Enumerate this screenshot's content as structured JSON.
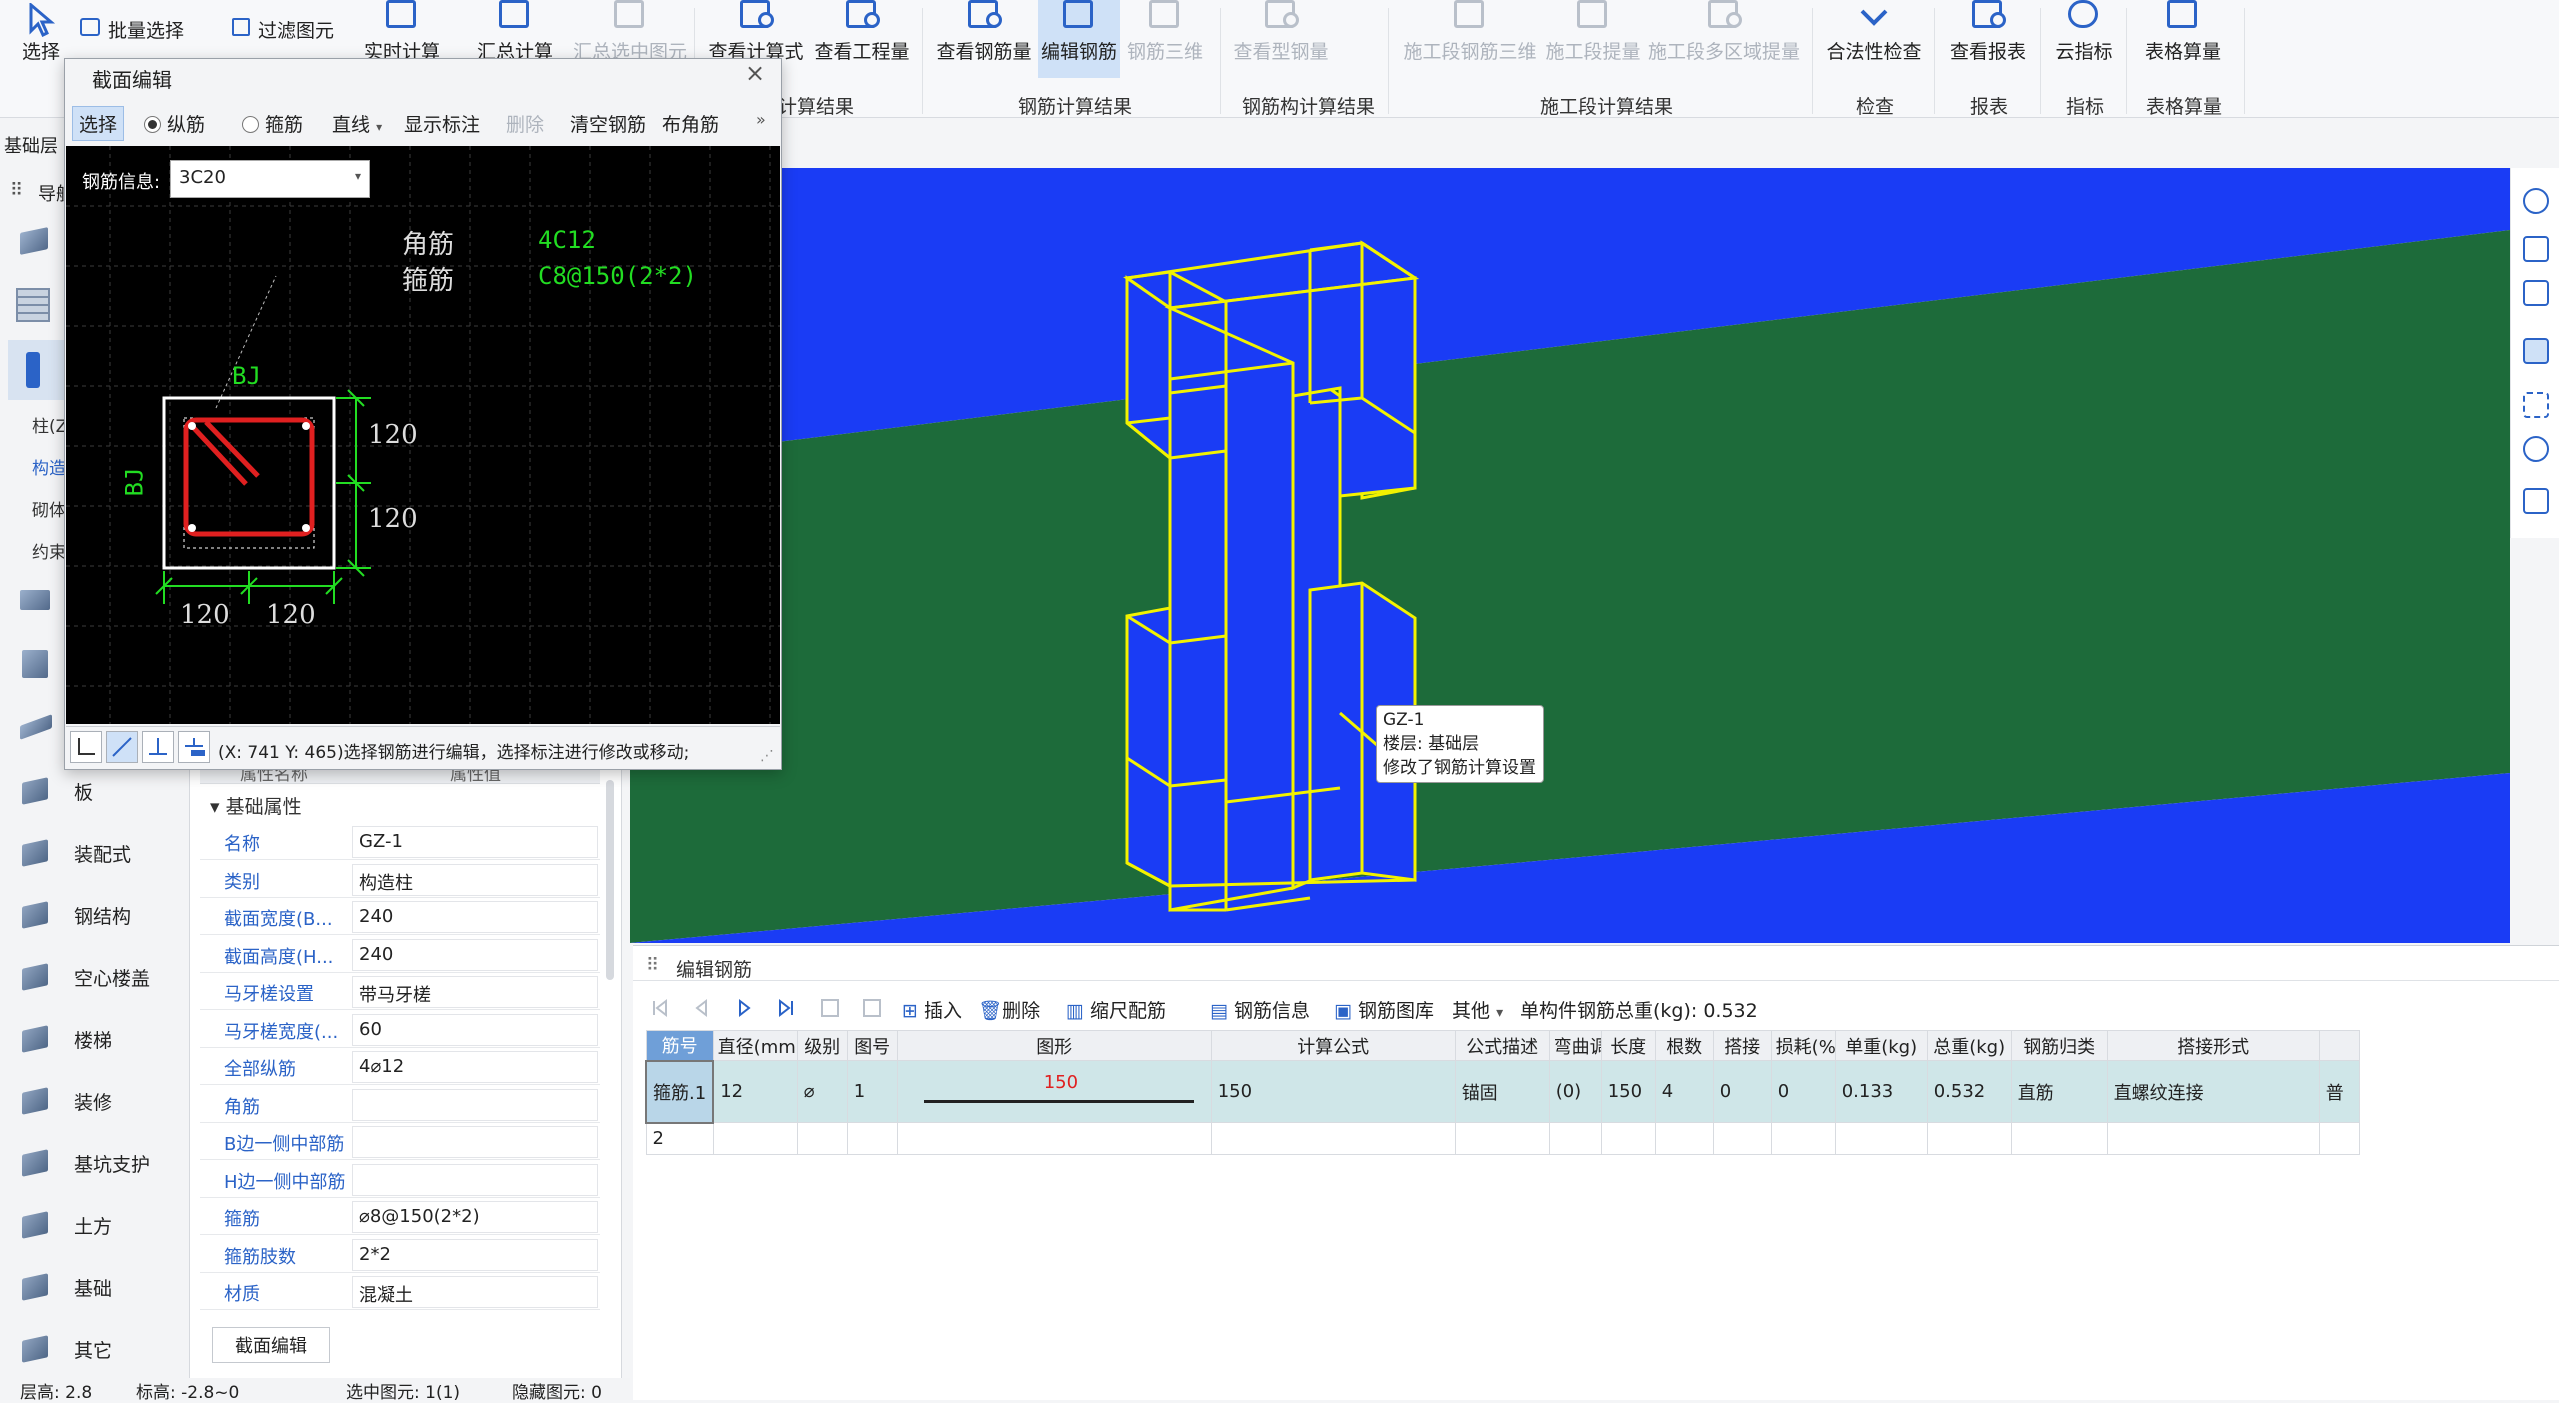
{
  "ribbon": {
    "buttons": [
      {
        "label": "选择",
        "icon": "select-arrow-icon"
      },
      {
        "label": "实时计算",
        "icon": "realtime-calc-icon"
      },
      {
        "label": "汇总计算",
        "icon": "sum-calc-icon"
      },
      {
        "label": "汇总选中图元",
        "icon": "sum-selected-icon"
      },
      {
        "label": "查看计算式",
        "icon": "view-formula-icon"
      },
      {
        "label": "查看工程量",
        "icon": "view-quantity-icon"
      },
      {
        "label": "查看钢筋量",
        "icon": "view-rebar-icon"
      },
      {
        "label": "编辑钢筋",
        "icon": "edit-rebar-icon"
      },
      {
        "label": "钢筋三维",
        "icon": "rebar-3d-icon"
      },
      {
        "label": "查看型钢量",
        "icon": "view-steel-icon"
      },
      {
        "label": "施工段钢筋三维",
        "icon": "segment-rebar-3d-icon"
      },
      {
        "label": "施工段提量",
        "icon": "segment-quantity-icon"
      },
      {
        "label": "施工段多区域提量",
        "icon": "segment-multi-area-icon"
      },
      {
        "label": "合法性检查",
        "icon": "check-icon"
      },
      {
        "label": "查看报表",
        "icon": "report-icon"
      },
      {
        "label": "云指标",
        "icon": "cloud-icon"
      },
      {
        "label": "表格算量",
        "icon": "table-calc-icon"
      }
    ],
    "small_buttons": [
      "批量选择",
      "过滤图元"
    ],
    "groups": [
      "计算结果",
      "钢筋计算结果",
      "钢筋构计算结果",
      "施工段计算结果",
      "检查",
      "报表",
      "指标",
      "表格算量"
    ]
  },
  "floor_label": "基础层",
  "nav_label": "导航",
  "sidebar": {
    "sub_items": [
      "柱(Z)",
      "构造",
      "砌体",
      "约束"
    ],
    "items": [
      "板",
      "装配式",
      "钢结构",
      "空心楼盖",
      "楼梯",
      "装修",
      "基坑支护",
      "土方",
      "基础",
      "其它"
    ]
  },
  "properties": {
    "col_header": "属性名称",
    "col_header_value": "属性值",
    "section": "基础属性",
    "rows": [
      {
        "key": "名称",
        "value": "GZ-1"
      },
      {
        "key": "类别",
        "value": "构造柱"
      },
      {
        "key": "截面宽度(B...",
        "value": "240"
      },
      {
        "key": "截面高度(H...",
        "value": "240"
      },
      {
        "key": "马牙槎设置",
        "value": "带马牙槎"
      },
      {
        "key": "马牙槎宽度(...",
        "value": "60"
      },
      {
        "key": "全部纵筋",
        "value": "4⌀12"
      },
      {
        "key": "角筋",
        "value": ""
      },
      {
        "key": "B边一侧中部筋",
        "value": ""
      },
      {
        "key": "H边一侧中部筋",
        "value": ""
      },
      {
        "key": "箍筋",
        "value": "⌀8@150(2*2)"
      },
      {
        "key": "箍筋肢数",
        "value": "2*2"
      },
      {
        "key": "材质",
        "value": "混凝土"
      }
    ],
    "edit_button": "截面编辑"
  },
  "status": {
    "floor_height": "层高: 2.8",
    "elevation": "标高: -2.8~0",
    "selected": "选中图元: 1(1)",
    "hidden": "隐藏图元: 0"
  },
  "tooltip": {
    "name": "GZ-1",
    "floor": "楼层: 基础层",
    "note": "修改了钢筋计算设置"
  },
  "dialog": {
    "title": "截面编辑",
    "toolbar": {
      "select": "选择",
      "longitudinal": "纵筋",
      "stirrup": "箍筋",
      "line": "直线",
      "show_dims": "显示标注",
      "delete": "删除",
      "clear": "清空钢筋",
      "corner": "布角筋"
    },
    "rebar_info_label": "钢筋信息:",
    "rebar_info_value": "3C20",
    "canvas": {
      "label_corner": "角筋",
      "label_stirrup": "箍筋",
      "value_corner": "4C12",
      "value_stirrup": "C8@150(2*2)",
      "bj_top": "BJ",
      "bj_left": "BJ",
      "dim_right_1": "120",
      "dim_right_2": "120",
      "dim_bottom_1": "120",
      "dim_bottom_2": "120"
    },
    "footer_text": "(X: 741 Y: 465)选择钢筋进行编辑，选择标注进行修改或移动;"
  },
  "rebar_panel": {
    "title": "编辑钢筋",
    "toolbar": {
      "insert": "插入",
      "delete": "删除",
      "scale": "缩尺配筋",
      "info": "钢筋信息",
      "library": "钢筋图库",
      "other": "其他",
      "total": "单构件钢筋总重(kg): 0.532"
    },
    "columns": [
      "筋号",
      "直径(mm)",
      "级别",
      "图号",
      "图形",
      "计算公式",
      "公式描述",
      "弯曲调整",
      "长度",
      "根数",
      "搭接",
      "损耗(%)",
      "单重(kg)",
      "总重(kg)",
      "钢筋归类",
      "搭接形式",
      ""
    ],
    "rows": [
      {
        "num": "1",
        "name": "箍筋.1",
        "diameter": "12",
        "grade": "⌀",
        "fig": "1",
        "shape_value": "150",
        "formula": "150",
        "desc": "锚固",
        "bend": "(0)",
        "length": "150",
        "count": "4",
        "lap": "0",
        "loss": "0",
        "unit_weight": "0.133",
        "total_weight": "0.532",
        "category": "直筋",
        "lap_type": "直螺纹连接",
        "extra": "普"
      }
    ],
    "empty_row_num": "2"
  },
  "colors": {
    "accent": "#2b63c7",
    "viewport_blue": "#1a3cf5",
    "viewport_green": "#1d6b3a",
    "wireframe": "#f2f200",
    "rebar_red": "#e02020",
    "cad_green": "#22dd22"
  }
}
